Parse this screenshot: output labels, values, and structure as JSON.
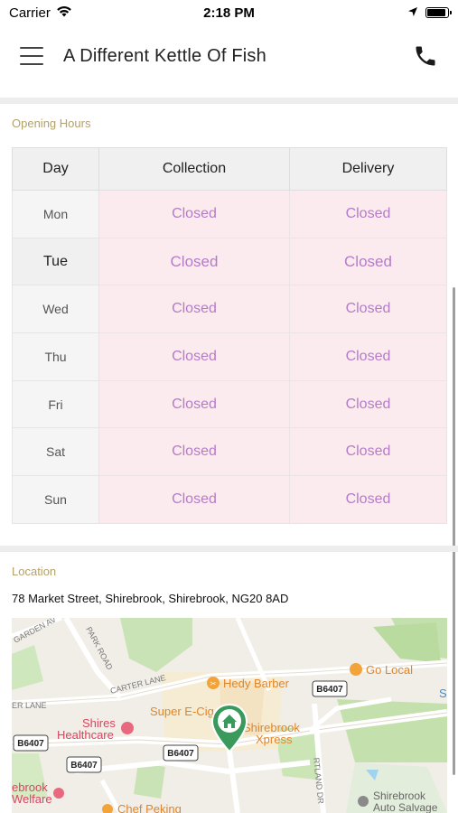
{
  "status_bar": {
    "carrier": "Carrier",
    "time": "2:18 PM",
    "battery_level": 0.9
  },
  "header": {
    "title": "A Different Kettle Of Fish",
    "menu_icon": "hamburger-menu-icon",
    "phone_icon": "phone-icon"
  },
  "opening_hours": {
    "section_title": "Opening Hours",
    "columns": [
      "Day",
      "Collection",
      "Delivery"
    ],
    "rows": [
      {
        "day": "Mon",
        "collection": "Closed",
        "delivery": "Closed"
      },
      {
        "day": "Tue",
        "collection": "Closed",
        "delivery": "Closed"
      },
      {
        "day": "Wed",
        "collection": "Closed",
        "delivery": "Closed"
      },
      {
        "day": "Thu",
        "collection": "Closed",
        "delivery": "Closed"
      },
      {
        "day": "Fri",
        "collection": "Closed",
        "delivery": "Closed"
      },
      {
        "day": "Sat",
        "collection": "Closed",
        "delivery": "Closed"
      },
      {
        "day": "Sun",
        "collection": "Closed",
        "delivery": "Closed"
      }
    ]
  },
  "location": {
    "section_title": "Location",
    "address": "78 Market Street, Shirebrook, Shirebrook, NG20 8AD",
    "map": {
      "labels": {
        "garden": "GARDEN AV",
        "park_road": "PARK ROAD",
        "carter_lane": "CARTER LANE",
        "er_lane": "ER LANE",
        "hedy_barber": "Hedy Barber",
        "go_local": "Go Local",
        "super_e": "Super E-Cig",
        "shires_hc_1": "Shires",
        "shires_hc_2": "Healthcare",
        "shirebrook_xpress_1": "Shirebrook",
        "shirebrook_xpress_2": "Xpress",
        "b6407_a": "B6407",
        "b6407_b": "B6407",
        "b6407_c": "B6407",
        "b6407_d": "B6407",
        "welfare_1": "ebrook",
        "welfare_2": "Welfare",
        "chef_peking": "Chef Peking",
        "rtland_dr": "RTLAND DR",
        "auto_salvage_1": "Shirebrook",
        "auto_salvage_2": "Auto Salvage",
        "edge_s": "S"
      }
    }
  }
}
